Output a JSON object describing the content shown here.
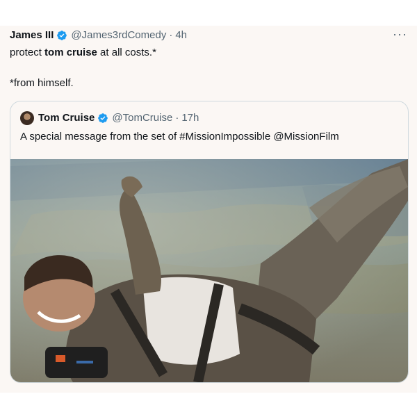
{
  "tweet": {
    "author_name": "James III",
    "author_handle": "@James3rdComedy",
    "separator": "·",
    "time": "4h",
    "text_pre": "protect ",
    "text_bold": "tom cruise",
    "text_post": " at all costs.*",
    "text_line2": "*from himself.",
    "more_label": "···"
  },
  "quote": {
    "author_name": "Tom Cruise",
    "author_handle": "@TomCruise",
    "separator": "·",
    "time": "17h",
    "text": "A special message from the set of #MissionImpossible @MissionFilm"
  },
  "colors": {
    "verified": "#1d9bf0",
    "background": "#fbf7f4",
    "secondary_text": "#536471",
    "border": "#cfd9de"
  },
  "icons": {
    "verified": "verified-badge-icon",
    "more": "more-options-icon"
  },
  "media": {
    "description_kind": "video-still"
  }
}
